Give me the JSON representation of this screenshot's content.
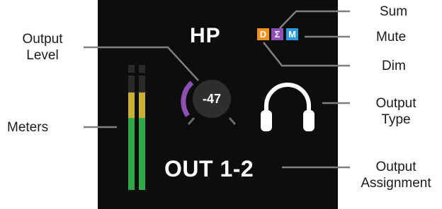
{
  "panel": {
    "title": "HP",
    "output_assignment": "OUT 1-2"
  },
  "badges": {
    "dim": {
      "letter": "D",
      "color": "#f0921e"
    },
    "sum": {
      "letter": "Σ",
      "color": "#8e4fb5"
    },
    "mute": {
      "letter": "M",
      "color": "#2a9de0"
    }
  },
  "knob": {
    "value": "-47",
    "level_color": "#8c4fb3"
  },
  "meters": {
    "green": "#2fa84a",
    "yellow": "#c9b032",
    "background": "#2a2a2a"
  },
  "callouts": {
    "output_level": [
      "Output",
      "Level"
    ],
    "meters": "Meters",
    "sum": "Sum",
    "mute": "Mute",
    "dim": "Dim",
    "output_type": [
      "Output",
      "Type"
    ],
    "output_assignment": [
      "Output",
      "Assignment"
    ]
  },
  "icons": {
    "output_type": "headphones-icon"
  }
}
